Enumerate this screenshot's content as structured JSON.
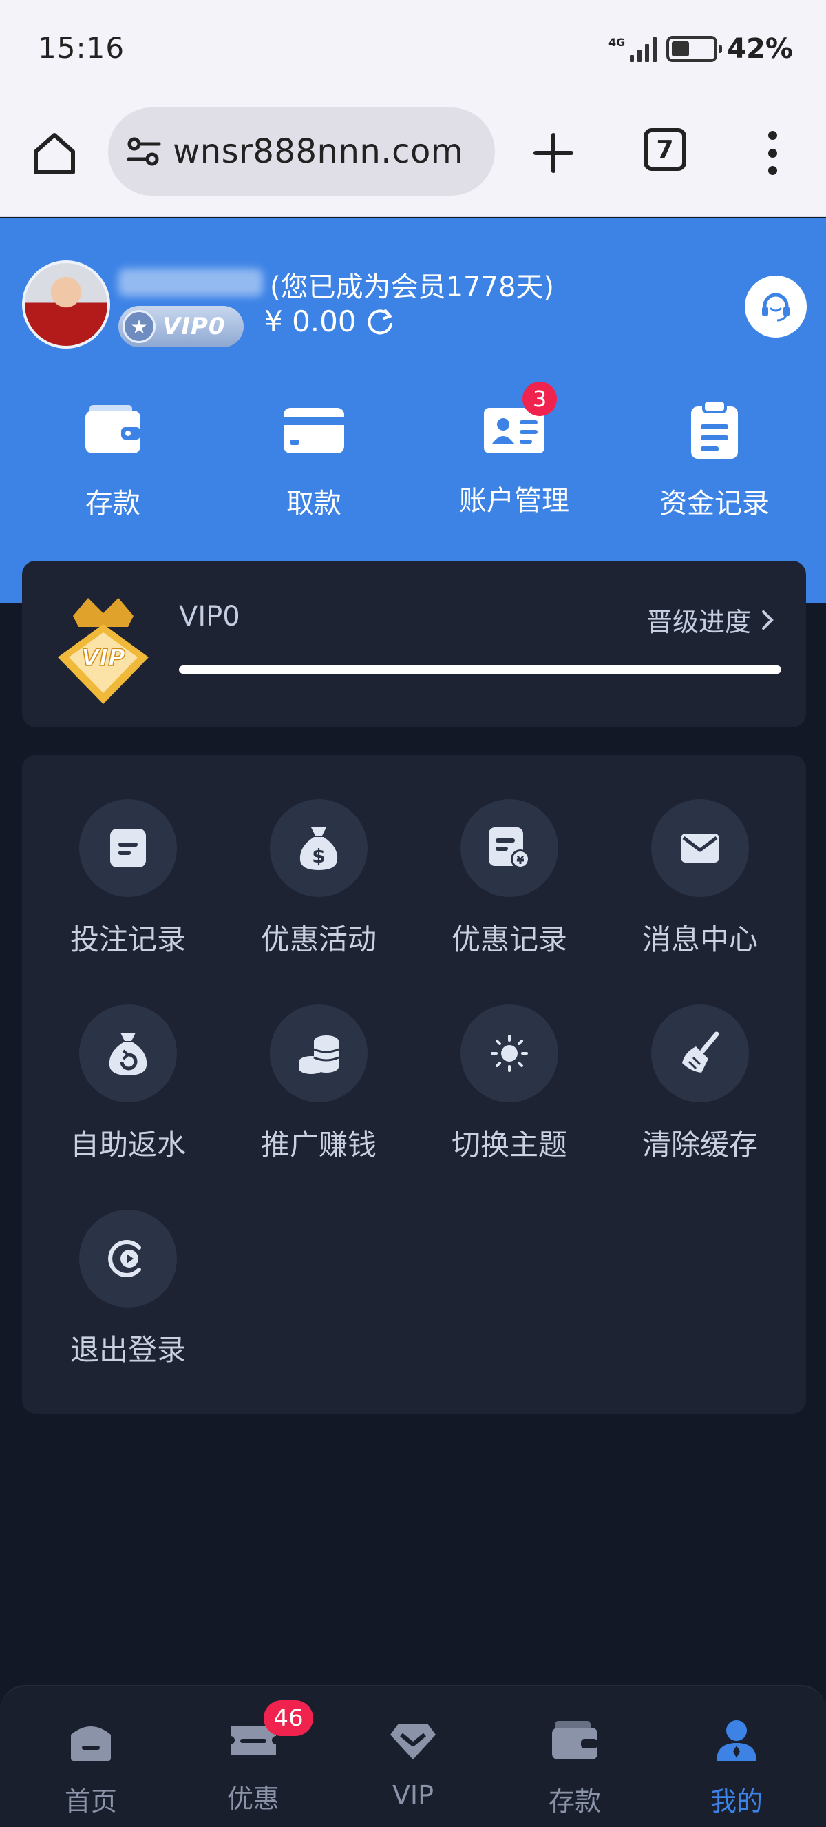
{
  "status_bar": {
    "time": "15:16",
    "network": "4G",
    "battery": "42%",
    "battery_level": 0.42
  },
  "browser": {
    "url": "wnsr888nnn.com",
    "tab_count": "7"
  },
  "profile": {
    "member_text": "(您已成为会员1778天)",
    "vip_badge": "VIP0",
    "balance": "¥ 0.00"
  },
  "quick_actions": [
    {
      "label": "存款",
      "icon": "wallet-icon"
    },
    {
      "label": "取款",
      "icon": "card-icon"
    },
    {
      "label": "账户管理",
      "icon": "id-card-icon",
      "badge": "3"
    },
    {
      "label": "资金记录",
      "icon": "clipboard-icon"
    }
  ],
  "vip_card": {
    "level": "VIP0",
    "progress_label": "晋级进度",
    "progress": 0
  },
  "menu_items": [
    {
      "label": "投注记录",
      "icon": "document-icon"
    },
    {
      "label": "优惠活动",
      "icon": "money-bag-icon"
    },
    {
      "label": "优惠记录",
      "icon": "receipt-icon"
    },
    {
      "label": "消息中心",
      "icon": "envelope-icon"
    },
    {
      "label": "自助返水",
      "icon": "refund-bag-icon"
    },
    {
      "label": "推广赚钱",
      "icon": "coin-stack-icon"
    },
    {
      "label": "切换主题",
      "icon": "sun-icon"
    },
    {
      "label": "清除缓存",
      "icon": "broom-icon"
    },
    {
      "label": "退出登录",
      "icon": "logout-icon"
    }
  ],
  "tab_bar": [
    {
      "label": "首页",
      "icon": "home-icon"
    },
    {
      "label": "优惠",
      "icon": "ticket-icon",
      "badge": "46"
    },
    {
      "label": "VIP",
      "icon": "diamond-icon"
    },
    {
      "label": "存款",
      "icon": "wallet-icon"
    },
    {
      "label": "我的",
      "icon": "user-icon",
      "active": true
    }
  ]
}
